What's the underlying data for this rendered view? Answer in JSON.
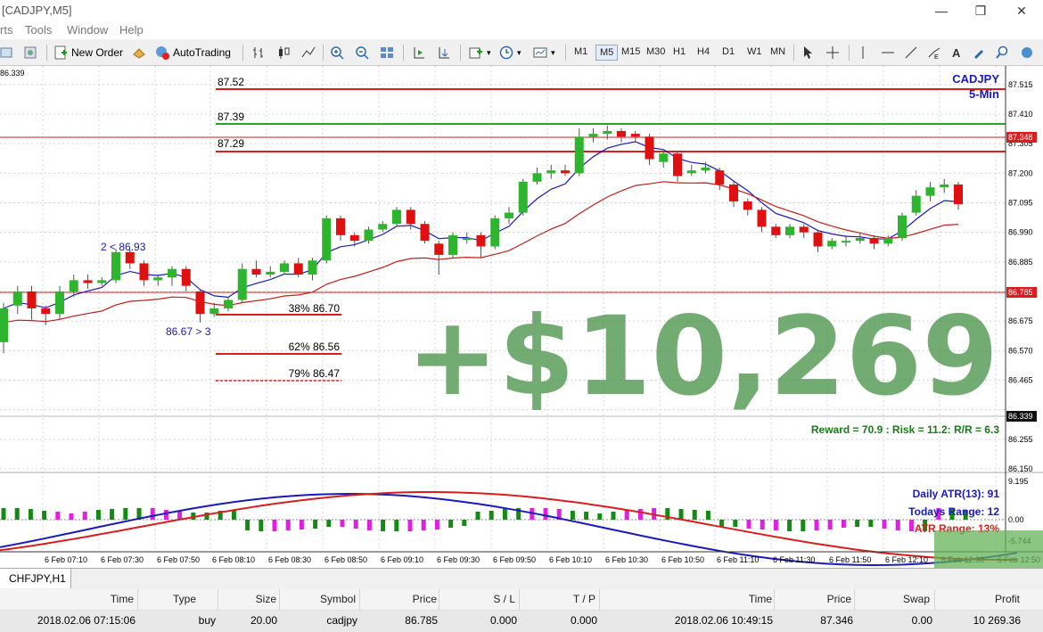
{
  "window": {
    "title": "[CADJPY,M5]",
    "controls": [
      "—",
      "❐",
      "✕"
    ]
  },
  "menu": [
    "rts",
    "Tools",
    "Window",
    "Help"
  ],
  "toolbar": {
    "new_order": "New Order",
    "autotrading": "AutoTrading",
    "timeframes": [
      "M1",
      "M5",
      "M15",
      "M30",
      "H1",
      "H4",
      "D1",
      "W1",
      "MN"
    ],
    "active_timeframe": "M5"
  },
  "chart": {
    "symbol": "CADJPY",
    "interval": "5-Min",
    "corner_price": "86.339",
    "level_labels": [
      "87.52",
      "87.39",
      "87.29"
    ],
    "fib_labels": [
      "38% 86.70",
      "62% 86.56",
      "79% 86.47"
    ],
    "annotations": [
      "2 < 86.93",
      "86.67 > 3"
    ],
    "profit_overlay": "+$10,269",
    "reward_risk": "Reward = 70.9 : Risk = 11.2: R/R = 6.3",
    "price_axis": [
      "87.515",
      "87.410",
      "87.305",
      "87.200",
      "87.095",
      "86.990",
      "86.885",
      "86.675",
      "86.570",
      "86.465",
      "86.255",
      "86.150"
    ],
    "price_badges": [
      "87.348",
      "86.785",
      "86.339"
    ],
    "indicator_axis": [
      "9.195",
      "0.00",
      "-5.744"
    ],
    "atr_lines": [
      "Daily ATR(13): 91",
      "Todays Range: 12",
      "ATR Range: 13%"
    ],
    "time_axis": [
      "6 Feb 07:10",
      "6 Feb 07:30",
      "6 Feb 07:50",
      "6 Feb 08:10",
      "6 Feb 08:30",
      "6 Feb 08:50",
      "6 Feb 09:10",
      "6 Feb 09:30",
      "6 Feb 09:50",
      "6 Feb 10:10",
      "6 Feb 10:30",
      "6 Feb 10:50",
      "6 Feb 11:10",
      "6 Feb 11:30",
      "6 Feb 11:50",
      "6 Feb 12:10",
      "6 Feb 12:30",
      "6 Feb 12:50"
    ],
    "colors": {
      "up": "#2db52d",
      "down": "#e01010",
      "resistance": "#d81e1e",
      "target": "#2ca02c",
      "fast_ma": "#1a1ab8",
      "slow_ma": "#c0201a",
      "overlay": "#3c8c3c"
    }
  },
  "chart_tab": "CHFJPY,H1",
  "terminal": {
    "headers": [
      "Time",
      "Type",
      "Size",
      "Symbol",
      "Price",
      "S / L",
      "T / P",
      "Time",
      "Price",
      "Swap",
      "Profit"
    ],
    "row": [
      "2018.02.06 07:15:06",
      "buy",
      "20.00",
      "cadjpy",
      "86.785",
      "0.000",
      "0.000",
      "2018.02.06 10:49:15",
      "87.346",
      "0.00",
      "10 269.36"
    ]
  }
}
